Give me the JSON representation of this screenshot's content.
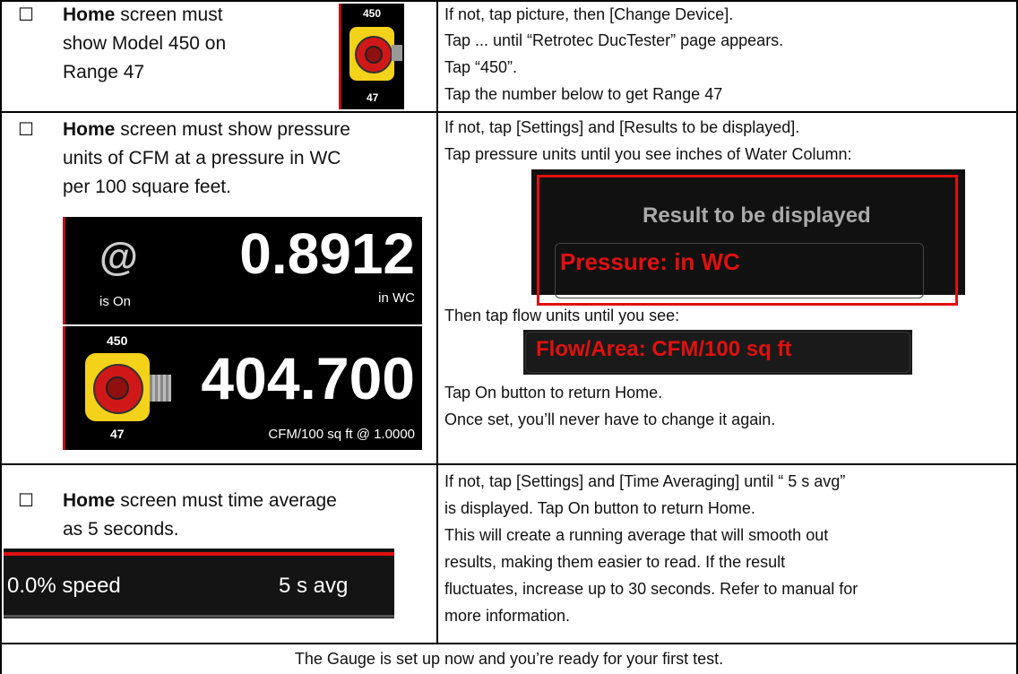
{
  "colors": {
    "accent_red": "#e01010",
    "panel_bg": "#000000",
    "meter_yellow": "#f4d21a"
  },
  "row1": {
    "checkbox": "☐",
    "left_bold": "Home",
    "left_lines": [
      " screen must",
      "show Model 450 on",
      "Range 47"
    ],
    "meter": {
      "model": "450",
      "range": "47"
    },
    "right_lines": [
      "If not, tap picture, then [Change Device].",
      "Tap ... until “Retrotec DucTester” page appears.",
      "Tap “450”.",
      "Tap the number below to get Range 47"
    ]
  },
  "row2": {
    "checkbox": "☐",
    "left_bold": "Home",
    "left_lines": [
      " screen must show pressure",
      "units of CFM at a pressure in WC",
      "per 100 square feet."
    ],
    "display": {
      "at_symbol": "@",
      "pressure_value": "0.8912",
      "status": "is On",
      "pressure_unit": "in WC",
      "model": "450",
      "range": "47",
      "flow_value": "404.700",
      "flow_unit": "CFM/100 sq ft @ 1.0000"
    },
    "right_lines_top": [
      "If not, tap [Settings] and [Results to be displayed].",
      " Tap pressure units until you see inches of Water Column:"
    ],
    "result_box": {
      "title": "Result to be displayed",
      "value": "Pressure: in WC"
    },
    "right_mid": "Then tap flow units until you see:",
    "flow_box": "Flow/Area: CFM/100 sq ft",
    "right_lines_bottom": [
      "Tap On button to return Home.",
      "Once set, you’ll never have to change it again."
    ]
  },
  "row3": {
    "checkbox": "☐",
    "left_bold": "Home",
    "left_lines": [
      " screen must time average",
      "as 5 seconds."
    ],
    "speed_bar": {
      "speed": "0.0% speed",
      "avg": "5 s avg"
    },
    "right_lines": [
      "If not, tap [Settings] and [Time Averaging] until “ 5 s avg”",
      "is displayed. Tap On button to return Home.",
      "This will create a running average that will smooth out",
      "results, making them easier to read. If the result",
      "fluctuates, increase up to 30 seconds. Refer to manual for",
      "more information."
    ]
  },
  "footer": {
    "text": "The Gauge is set up now and you’re ready for your first test."
  }
}
